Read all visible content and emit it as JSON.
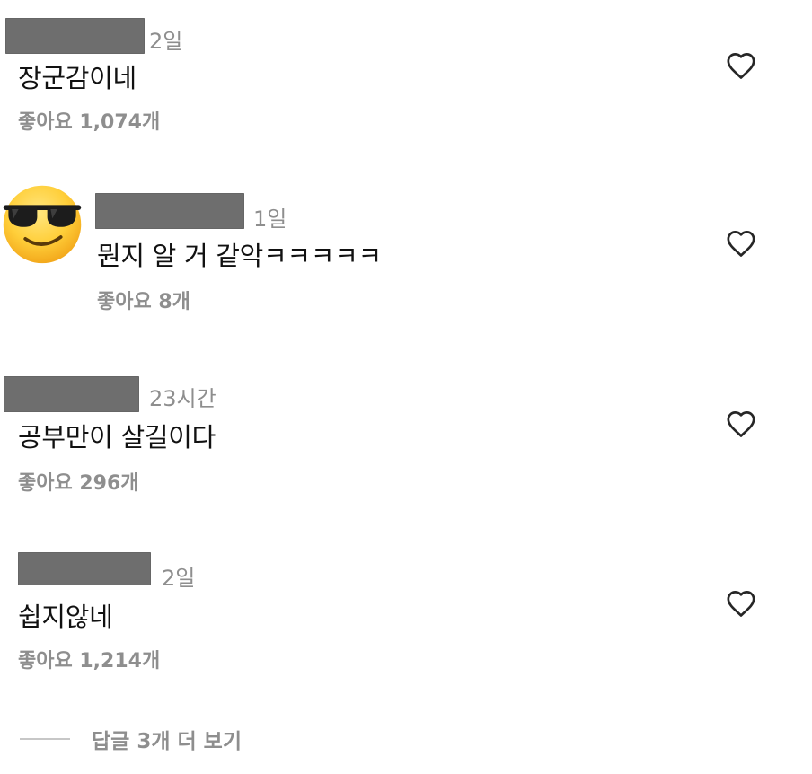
{
  "comments": [
    {
      "time": "2일",
      "text": "장군감이네",
      "likes": "좋아요 1,074개"
    },
    {
      "time": "1일",
      "text": "뭔지 알 거 같악ㅋㅋㅋㅋㅋ",
      "likes": "좋아요 8개"
    },
    {
      "time": "23시간",
      "text": "공부만이 살길이다",
      "likes": "좋아요 296개"
    },
    {
      "time": "2일",
      "text": "쉽지않네",
      "likes": "좋아요 1,214개"
    }
  ],
  "view_replies": "답글 3개 더 보기",
  "icons": {
    "like": "heart-outline-icon",
    "avatar": "sunglasses-emoji-avatar"
  },
  "colors": {
    "redaction": "#6e6e6e",
    "meta_text": "#8e8e8e",
    "body_text": "#111111"
  }
}
